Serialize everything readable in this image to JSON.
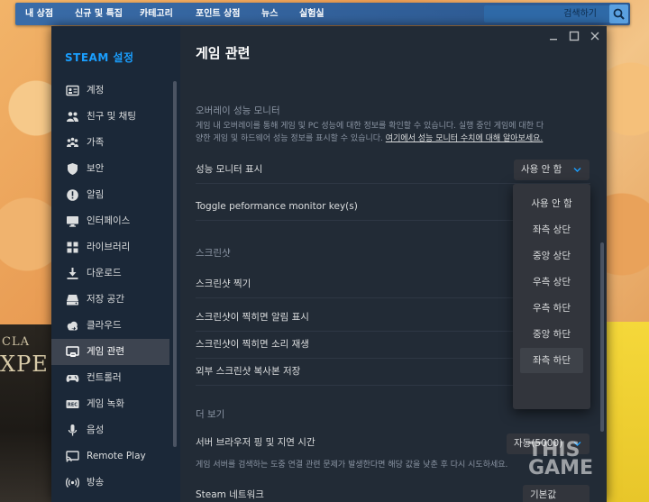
{
  "store_nav": {
    "items": [
      "내 상점",
      "신규 및 특집",
      "카테고리",
      "포인트 상점",
      "뉴스",
      "실험실"
    ],
    "search_placeholder": "검색하기"
  },
  "sidebar": {
    "brand": "STEAM 설정",
    "active_index": 10,
    "items": [
      {
        "label": "계정",
        "icon": "account-card-icon"
      },
      {
        "label": "친구 및 채팅",
        "icon": "friends-icon"
      },
      {
        "label": "가족",
        "icon": "family-icon"
      },
      {
        "label": "보안",
        "icon": "shield-icon"
      },
      {
        "label": "알림",
        "icon": "alert-icon"
      },
      {
        "label": "인터페이스",
        "icon": "monitor-icon"
      },
      {
        "label": "라이브러리",
        "icon": "grid-icon"
      },
      {
        "label": "다운로드",
        "icon": "download-icon"
      },
      {
        "label": "저장 공간",
        "icon": "storage-icon"
      },
      {
        "label": "클라우드",
        "icon": "cloud-icon"
      },
      {
        "label": "게임 관련",
        "icon": "game-monitor-icon"
      },
      {
        "label": "컨트롤러",
        "icon": "gamepad-icon"
      },
      {
        "label": "게임 녹화",
        "icon": "rec-icon"
      },
      {
        "label": "음성",
        "icon": "microphone-icon"
      },
      {
        "label": "Remote Play",
        "icon": "remote-play-icon"
      },
      {
        "label": "방송",
        "icon": "broadcast-icon"
      }
    ]
  },
  "main": {
    "title": "게임 관련",
    "overlay_section": "오버레이 성능 모니터",
    "overlay_desc_1": "게임 내 오버레이를 통해 게임 및 PC 성능에 대한 정보를 확인할 수 있습니다. 실행 중인 게임에 대한 다",
    "overlay_desc_2": "양한 게임 및 하드웨어 성능 정보를 표시할 수 있습니다.",
    "overlay_desc_link": "여기에서 성능 모니터 수치에 대해 알아보세요.",
    "perf_monitor_label": "성능 모니터 표시",
    "perf_monitor_value": "사용 안 함",
    "toggle_key_label": "Toggle peformance monitor key(s)",
    "screenshot_section": "스크린샷",
    "screenshot_rows": [
      "스크린샷 찍기",
      "스크린샷이 찍히면 알림 표시",
      "스크린샷이 찍히면 소리 재생",
      "외부 스크린샷 복사본 저장"
    ],
    "more_section": "더 보기",
    "server_ping_label": "서버 브라우저 핑 및 지연 시간",
    "server_ping_value": "자동(5000)",
    "server_ping_desc": "게임 서버를 검색하는 도중 연결 관련 문제가 발생한다면 해당 값을 낮춘 후 다시 시도하세요.",
    "steam_network_label": "Steam 네트워크",
    "steam_network_value": "기본값"
  },
  "dropdown_menu": {
    "options": [
      "사용 안 함",
      "좌측 상단",
      "중앙 상단",
      "우측 상단",
      "우측 하단",
      "중앙 하단",
      "좌측 하단"
    ],
    "hover_index": 6
  },
  "background": {
    "text_small": "CLA",
    "text_large": "XPE"
  },
  "watermark": "THIS\nGAME",
  "colors": {
    "accent": "#1a9fff",
    "store_nav": "#3a6ca8",
    "window_bg": "#1b2838",
    "main_bg": "#222b36",
    "active_item": "#3d4450"
  }
}
